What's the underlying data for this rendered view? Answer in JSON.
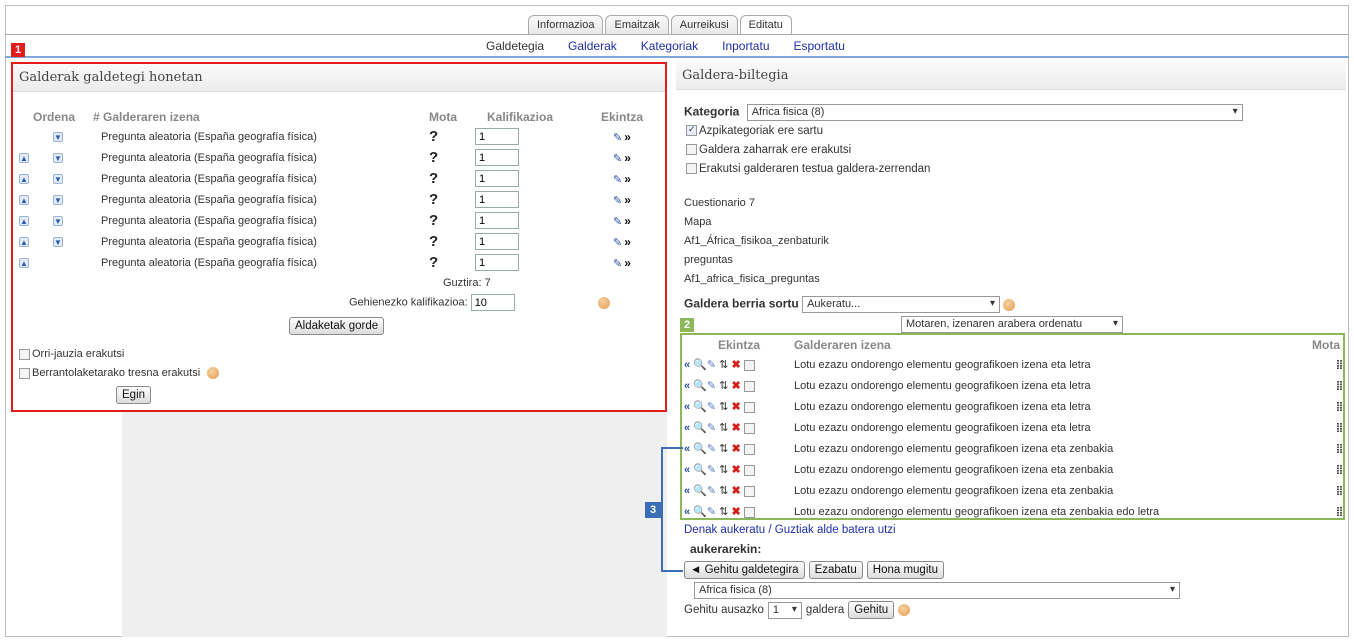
{
  "tabs": [
    "Informazioa",
    "Emaitzak",
    "Aurreikusi",
    "Editatu"
  ],
  "subtabs": [
    "Galdetegia",
    "Galderak",
    "Kategoriak",
    "Inportatu",
    "Esportatu"
  ],
  "colors": {
    "red": "#e21b1b",
    "green": "#8db85a",
    "blue": "#3a6fb5"
  },
  "left": {
    "badge": "1",
    "title": "Galderak galdetegi honetan",
    "headers": {
      "ordena": "Ordena",
      "name": "# Galderaren izena",
      "mota": "Mota",
      "grade": "Kalifikazioa",
      "action": "Ekintza"
    },
    "rows": [
      {
        "name": "Pregunta aleatoria (España geografía física)",
        "grade": "1"
      },
      {
        "name": "Pregunta aleatoria (España geografía física)",
        "grade": "1"
      },
      {
        "name": "Pregunta aleatoria (España geografía física)",
        "grade": "1"
      },
      {
        "name": "Pregunta aleatoria (España geografía física)",
        "grade": "1"
      },
      {
        "name": "Pregunta aleatoria (España geografía física)",
        "grade": "1"
      },
      {
        "name": "Pregunta aleatoria (España geografía física)",
        "grade": "1"
      },
      {
        "name": "Pregunta aleatoria (España geografía física)",
        "grade": "1"
      }
    ],
    "total_label": "Guztira: 7",
    "maxgrade_label": "Gehienezko kalifikazioa:",
    "maxgrade_value": "10",
    "save_button": "Aldaketak gorde",
    "show_pagebreaks": "Orri-jauzia erakutsi",
    "show_reorder": "Berrantolaketarako tresna erakutsi",
    "go_button": "Egin"
  },
  "right": {
    "title": "Galdera-biltegia",
    "category_label": "Kategoria",
    "category_value": "Africa fisica (8)",
    "opt_subcats": "Azpikategoriak ere sartu",
    "opt_old": "Galdera zaharrak ere erakutsi",
    "opt_text": "Erakutsi galderaren testua galdera-zerrendan",
    "info_lines": [
      "Cuestionario 7",
      "Mapa",
      "Af1_África_fisikoa_zenbaturik",
      "preguntas",
      "Af1_africa_fisica_preguntas"
    ],
    "create_label": "Galdera berria sortu",
    "create_select": "Aukeratu...",
    "sort_select": "Motaren, izenaren arabera ordenatu",
    "badge2": "2",
    "badge3": "3",
    "headers": {
      "action": "Ekintza",
      "name": "Galderaren izena",
      "mota": "Mota"
    },
    "rows": [
      "Lotu ezazu ondorengo elementu geografikoen izena eta letra",
      "Lotu ezazu ondorengo elementu geografikoen izena eta letra",
      "Lotu ezazu ondorengo elementu geografikoen izena eta letra",
      "Lotu ezazu ondorengo elementu geografikoen izena eta letra",
      "Lotu ezazu ondorengo elementu geografikoen izena eta zenbakia",
      "Lotu ezazu ondorengo elementu geografikoen izena eta zenbakia",
      "Lotu ezazu ondorengo elementu geografikoen izena eta zenbakia",
      "Lotu ezazu ondorengo elementu geografikoen izena eta zenbakia edo letra"
    ],
    "select_all": "Denak aukeratu / Guztiak alde batera utzi",
    "with_selected": "aukerarekin:",
    "btn_add": "◄ Gehitu galdetegira",
    "btn_delete": "Ezabatu",
    "btn_move": "Hona mugitu",
    "move_target": "Africa fisica (8)",
    "random_prefix": "Gehitu ausazko",
    "random_count": "1",
    "random_suffix": "galdera",
    "random_button": "Gehitu"
  }
}
